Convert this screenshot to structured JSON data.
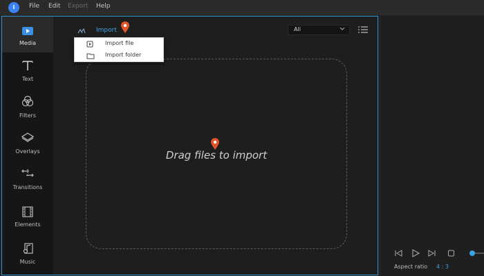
{
  "menu": {
    "logo_text": "i",
    "items": [
      "File",
      "Edit",
      "Export",
      "Help"
    ]
  },
  "sidebar": {
    "items": [
      {
        "label": "Media",
        "icon": "media-icon"
      },
      {
        "label": "Text",
        "icon": "text-icon"
      },
      {
        "label": "Filters",
        "icon": "filters-icon"
      },
      {
        "label": "Overlays",
        "icon": "overlays-icon"
      },
      {
        "label": "Transitions",
        "icon": "transitions-icon"
      },
      {
        "label": "Elements",
        "icon": "elements-icon"
      },
      {
        "label": "Music",
        "icon": "music-icon"
      }
    ],
    "active_index": 0
  },
  "toolbar": {
    "import_label": "Import",
    "filter_value": "All"
  },
  "import_menu": {
    "items": [
      "Import file",
      "Import folder"
    ]
  },
  "dropzone": {
    "text": "Drag files to import"
  },
  "preview": {
    "aspect_label": "Aspect ratio",
    "aspect_value": "4 : 3"
  },
  "colors": {
    "accent": "#3aa3e6",
    "pin": "#e0552a",
    "panel_border": "#2f95d0"
  }
}
